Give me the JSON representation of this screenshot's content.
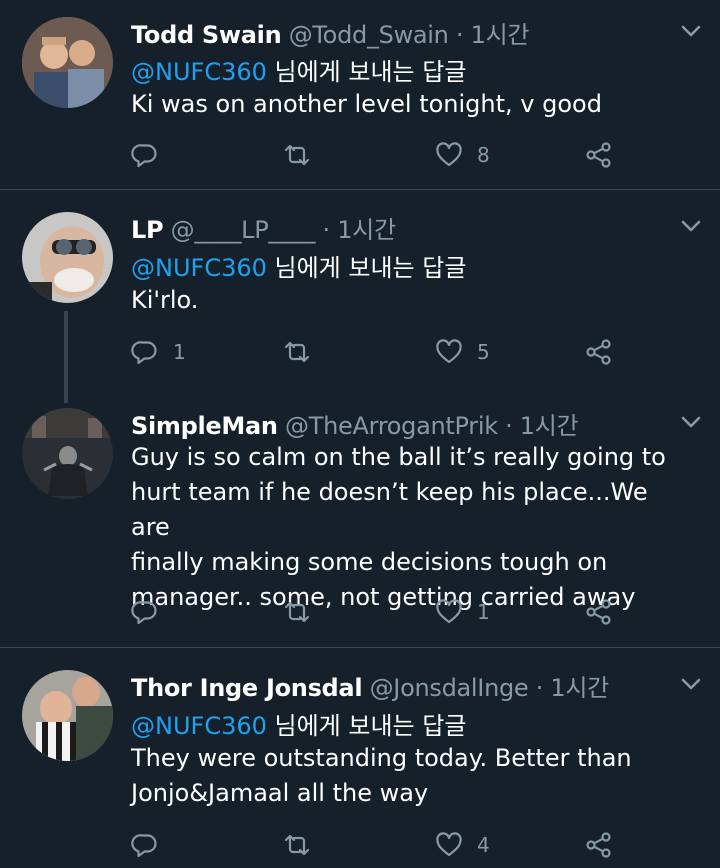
{
  "colors": {
    "background": "#15202b",
    "divider": "#38444d",
    "mention": "#1da1f2",
    "secondary": "#8899a6"
  },
  "tweets": [
    {
      "name": "Todd Swain",
      "handle": "@Todd_Swain",
      "time": "· 1시간",
      "reply_mention": "@NUFC360",
      "reply_suffix": " 님에게 보내는 답글",
      "lines": [
        "Ki was on another level tonight, v good"
      ],
      "replies": "",
      "retweets": "",
      "likes": "8"
    },
    {
      "name": "LP",
      "handle": "@____LP____",
      "time": "· 1시간",
      "reply_mention": "@NUFC360",
      "reply_suffix": " 님에게 보내는 답글",
      "lines": [
        "Ki'rlo."
      ],
      "replies": "1",
      "retweets": "",
      "likes": "5"
    },
    {
      "name": "SimpleMan",
      "handle": "@TheArrogantPrik",
      "time": "· 1시간",
      "lines": [
        "Guy is so calm on the ball it’s really going to",
        "hurt team if he doesn’t keep his place...We are",
        "finally making some decisions tough on",
        "manager.. some, not getting carried away"
      ],
      "replies": "",
      "retweets": "",
      "likes": "1"
    },
    {
      "name": "Thor Inge Jonsdal",
      "handle": "@JonsdalInge",
      "time": "· 1시간",
      "reply_mention": "@NUFC360",
      "reply_suffix": " 님에게 보내는 답글",
      "lines": [
        "They were outstanding today. Better than",
        "Jonjo&Jamaal all the way"
      ],
      "replies": "",
      "retweets": "",
      "likes": "4"
    }
  ]
}
